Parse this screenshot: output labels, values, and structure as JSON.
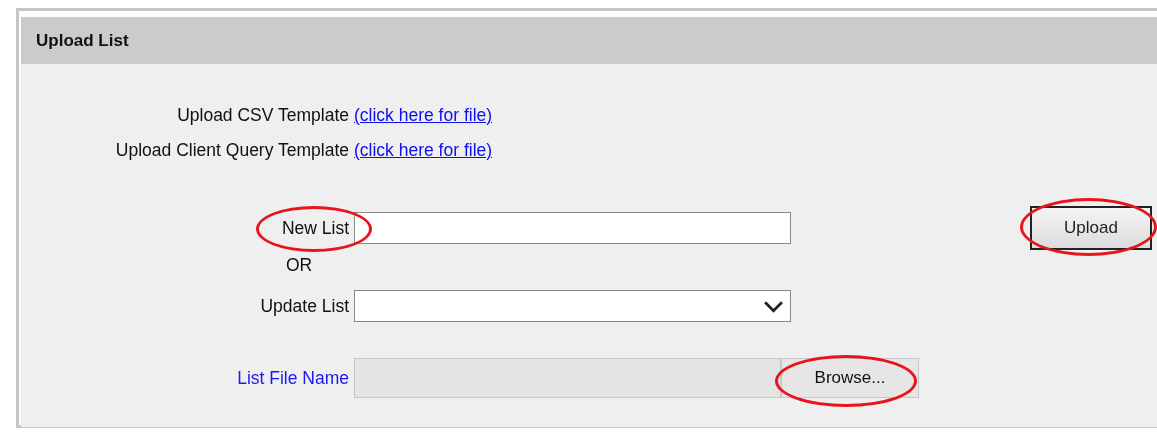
{
  "panel": {
    "title": "Upload List"
  },
  "templates": [
    {
      "label": "Upload CSV Template",
      "link": "(click here for file)"
    },
    {
      "label": "Upload Client Query Template",
      "link": "(click here for file)"
    }
  ],
  "new_list": {
    "label": "New List",
    "circled": true
  },
  "separator": "OR",
  "update_list": {
    "label": "Update List"
  },
  "file": {
    "label": "List File Name",
    "button": "Browse...",
    "circled": true
  },
  "upload_button": {
    "label": "Upload",
    "circled": true
  }
}
